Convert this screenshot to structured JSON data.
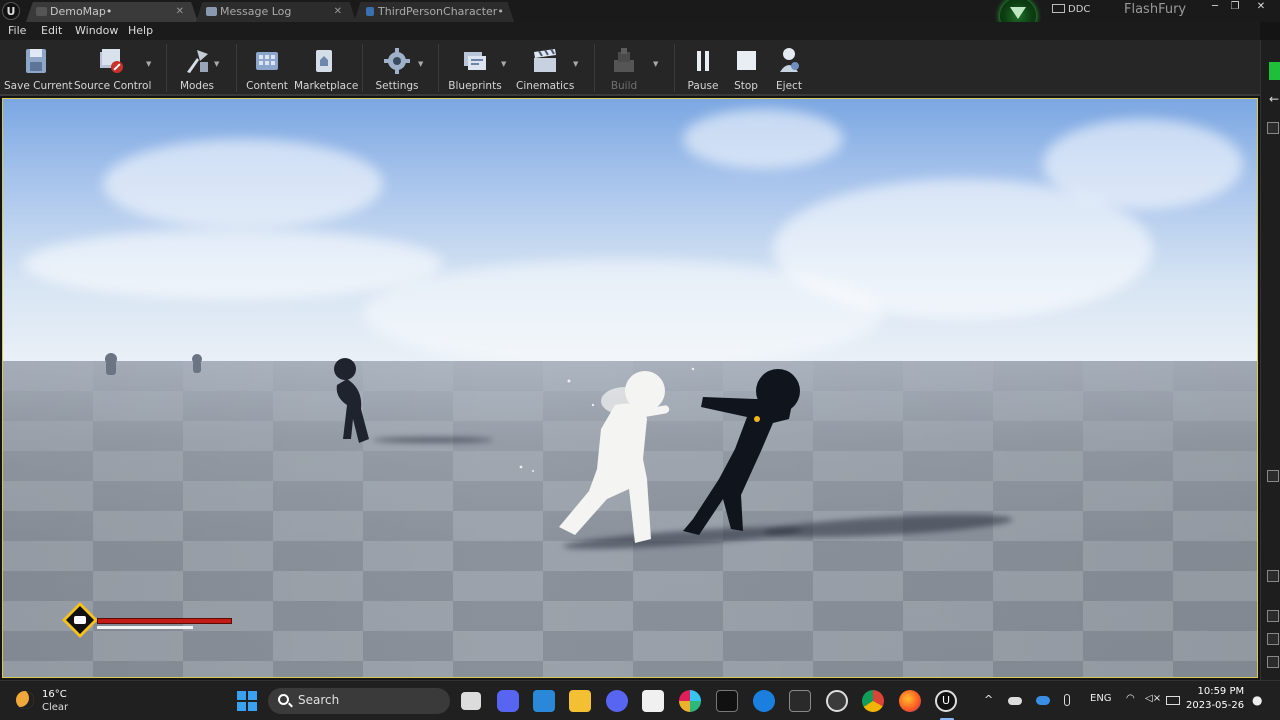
{
  "window": {
    "tabs": [
      {
        "label": "DemoMap•",
        "active": true
      },
      {
        "label": "Message Log",
        "active": false
      },
      {
        "label": "ThirdPersonCharacter•",
        "active": false
      }
    ],
    "status": {
      "ddc_label": "DDC",
      "project_name": "FlashFury"
    },
    "controls": {
      "minimize": "─",
      "maximize": "❐",
      "close": "✕"
    }
  },
  "menu": [
    "File",
    "Edit",
    "Window",
    "Help"
  ],
  "toolbar": {
    "save_current": "Save Current",
    "source_control": "Source Control",
    "modes": "Modes",
    "content": "Content",
    "marketplace": "Marketplace",
    "settings": "Settings",
    "blueprints": "Blueprints",
    "cinematics": "Cinematics",
    "build": "Build",
    "pause": "Pause",
    "stop": "Stop",
    "eject": "Eject"
  },
  "hud": {
    "health_fraction": 1.0,
    "stamina_fraction": 0.71
  },
  "taskbar": {
    "weather_temp": "16°C",
    "weather_condition": "Clear",
    "search_label": "Search",
    "language": "ENG",
    "time": "10:59 PM",
    "date": "2023-05-26"
  },
  "colors": {
    "accent_green": "#2bd23b",
    "health_red": "#c21a14",
    "viewport_border": "#d8c95a"
  }
}
